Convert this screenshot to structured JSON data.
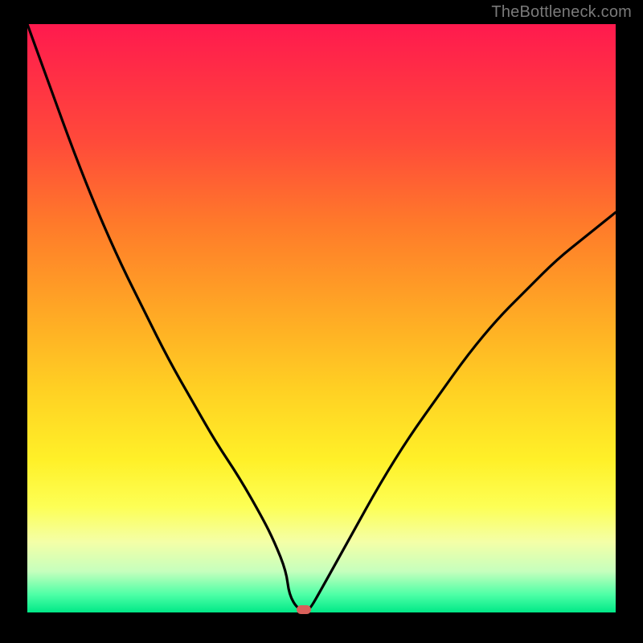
{
  "watermark": "TheBottleneck.com",
  "colors": {
    "dot_fill": "#d9605a",
    "curve_stroke": "#000000"
  },
  "chart_data": {
    "type": "line",
    "title": "",
    "xlabel": "",
    "ylabel": "",
    "xlim": [
      0,
      100
    ],
    "ylim": [
      0,
      100
    ],
    "grid": false,
    "legend": false,
    "annotations": [
      "TheBottleneck.com"
    ],
    "series": [
      {
        "name": "curve",
        "x": [
          0,
          4,
          8,
          12,
          16,
          20,
          24,
          28,
          32,
          36,
          40,
          42,
          44,
          44.5,
          46,
          47.5,
          48,
          50,
          55,
          60,
          65,
          70,
          75,
          80,
          85,
          90,
          95,
          100
        ],
        "y": [
          100,
          89,
          78,
          68,
          59,
          51,
          43,
          36,
          29,
          23,
          16,
          12,
          7,
          3,
          0.5,
          0.5,
          0.5,
          4,
          13,
          22,
          30,
          37,
          44,
          50,
          55,
          60,
          64,
          68
        ]
      }
    ],
    "marker": {
      "x": 47,
      "y": 0.5
    }
  }
}
